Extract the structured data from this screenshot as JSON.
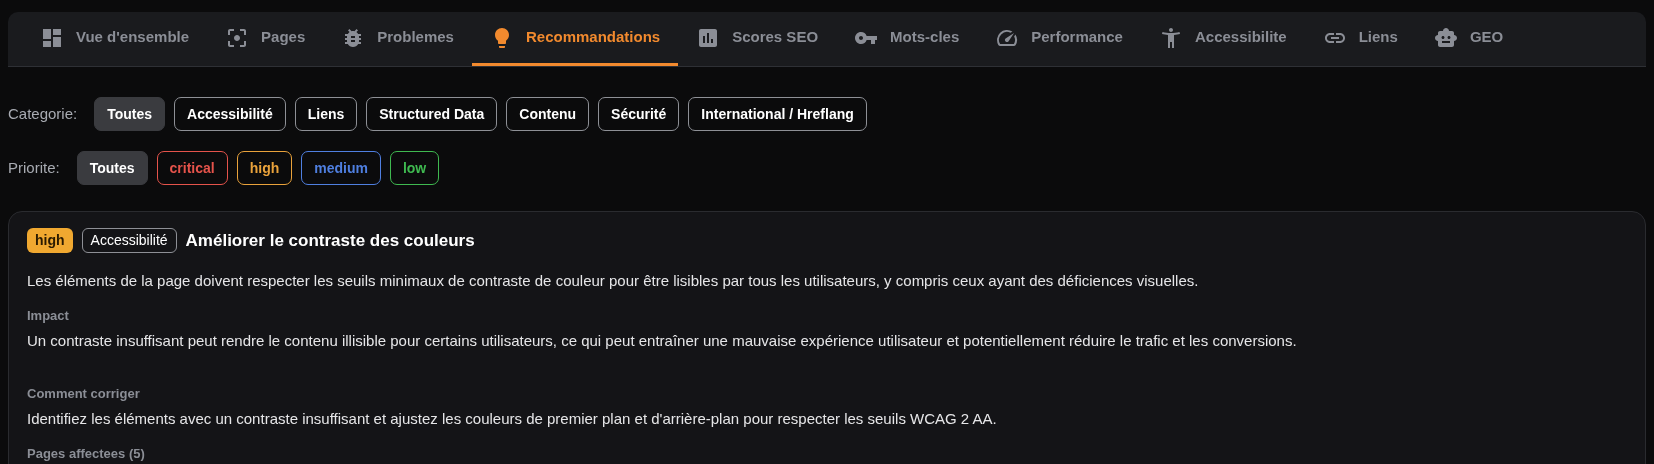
{
  "tabs": [
    {
      "label": "Vue d'ensemble",
      "selected": false
    },
    {
      "label": "Pages",
      "selected": false
    },
    {
      "label": "Problemes",
      "selected": false
    },
    {
      "label": "Recommandations",
      "selected": true
    },
    {
      "label": "Scores SEO",
      "selected": false
    },
    {
      "label": "Mots-cles",
      "selected": false
    },
    {
      "label": "Performance",
      "selected": false
    },
    {
      "label": "Accessibilite",
      "selected": false
    },
    {
      "label": "Liens",
      "selected": false
    },
    {
      "label": "GEO",
      "selected": false
    }
  ],
  "category_filter": {
    "label": "Categorie:",
    "options": [
      {
        "label": "Toutes",
        "selected": true
      },
      {
        "label": "Accessibilité",
        "selected": false
      },
      {
        "label": "Liens",
        "selected": false
      },
      {
        "label": "Structured Data",
        "selected": false
      },
      {
        "label": "Contenu",
        "selected": false
      },
      {
        "label": "Sécurité",
        "selected": false
      },
      {
        "label": "International / Hreflang",
        "selected": false
      }
    ]
  },
  "priority_filter": {
    "label": "Priorite:",
    "options": [
      {
        "label": "Toutes",
        "selected": true
      },
      {
        "label": "critical",
        "selected": false,
        "color": "#e5534b"
      },
      {
        "label": "high",
        "selected": false,
        "color": "#e9a23b"
      },
      {
        "label": "medium",
        "selected": false,
        "color": "#4f7fe0"
      },
      {
        "label": "low",
        "selected": false,
        "color": "#3fb950"
      }
    ]
  },
  "recommendation": {
    "priority": "high",
    "category": "Accessibilité",
    "title": "Améliorer le contraste des couleurs",
    "description": "Les éléments de la page doivent respecter les seuils minimaux de contraste de couleur pour être lisibles par tous les utilisateurs, y compris ceux ayant des déficiences visuelles.",
    "sections": [
      {
        "heading": "Impact",
        "text": "Un contraste insuffisant peut rendre le contenu illisible pour certains utilisateurs, ce qui peut entraîner une mauvaise expérience utilisateur et potentiellement réduire le trafic et les conversions."
      },
      {
        "heading": "Comment corriger",
        "text": "Identifiez les éléments avec un contraste insuffisant et ajustez les couleurs de premier plan et d'arrière-plan pour respecter les seuils WCAG 2 AA."
      }
    ],
    "pages_heading": "Pages affectees (5)"
  }
}
